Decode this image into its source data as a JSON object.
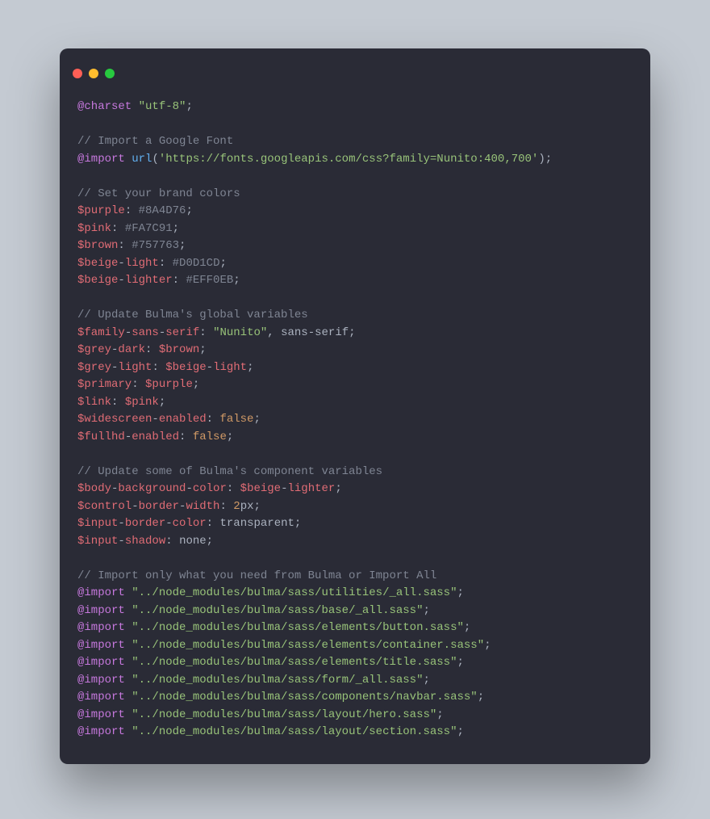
{
  "lines": [
    [
      {
        "cls": "tk-kw",
        "t": "@charset "
      },
      {
        "cls": "tk-str",
        "t": "\"utf-8\""
      },
      {
        "cls": "tk-punct",
        "t": ";"
      }
    ],
    [],
    [
      {
        "cls": "tk-comment",
        "t": "// Import a Google Font"
      }
    ],
    [
      {
        "cls": "tk-kw",
        "t": "@import "
      },
      {
        "cls": "tk-fn",
        "t": "url"
      },
      {
        "cls": "tk-punct",
        "t": "("
      },
      {
        "cls": "tk-str",
        "t": "'https://fonts.googleapis.com/css?family=Nunito:400,700'"
      },
      {
        "cls": "tk-punct",
        "t": ");"
      }
    ],
    [],
    [
      {
        "cls": "tk-comment",
        "t": "// Set your brand colors"
      }
    ],
    [
      {
        "cls": "tk-prop",
        "t": "$purple"
      },
      {
        "cls": "tk-punct",
        "t": ": "
      },
      {
        "cls": "tk-hex",
        "t": "#8A4D76"
      },
      {
        "cls": "tk-punct",
        "t": ";"
      }
    ],
    [
      {
        "cls": "tk-prop",
        "t": "$pink"
      },
      {
        "cls": "tk-punct",
        "t": ": "
      },
      {
        "cls": "tk-hex",
        "t": "#FA7C91"
      },
      {
        "cls": "tk-punct",
        "t": ";"
      }
    ],
    [
      {
        "cls": "tk-prop",
        "t": "$brown"
      },
      {
        "cls": "tk-punct",
        "t": ": "
      },
      {
        "cls": "tk-hex",
        "t": "#757763"
      },
      {
        "cls": "tk-punct",
        "t": ";"
      }
    ],
    [
      {
        "cls": "tk-prop",
        "t": "$beige"
      },
      {
        "cls": "tk-punct",
        "t": "-"
      },
      {
        "cls": "tk-prop",
        "t": "light"
      },
      {
        "cls": "tk-punct",
        "t": ": "
      },
      {
        "cls": "tk-hex",
        "t": "#D0D1CD"
      },
      {
        "cls": "tk-punct",
        "t": ";"
      }
    ],
    [
      {
        "cls": "tk-prop",
        "t": "$beige"
      },
      {
        "cls": "tk-punct",
        "t": "-"
      },
      {
        "cls": "tk-prop",
        "t": "lighter"
      },
      {
        "cls": "tk-punct",
        "t": ": "
      },
      {
        "cls": "tk-hex",
        "t": "#EFF0EB"
      },
      {
        "cls": "tk-punct",
        "t": ";"
      }
    ],
    [],
    [
      {
        "cls": "tk-comment",
        "t": "// Update Bulma's global variables"
      }
    ],
    [
      {
        "cls": "tk-prop",
        "t": "$family"
      },
      {
        "cls": "tk-punct",
        "t": "-"
      },
      {
        "cls": "tk-prop",
        "t": "sans"
      },
      {
        "cls": "tk-punct",
        "t": "-"
      },
      {
        "cls": "tk-prop",
        "t": "serif"
      },
      {
        "cls": "tk-punct",
        "t": ": "
      },
      {
        "cls": "tk-str",
        "t": "\"Nunito\""
      },
      {
        "cls": "tk-punct",
        "t": ", "
      },
      {
        "cls": "tk-plain",
        "t": "sans"
      },
      {
        "cls": "tk-punct",
        "t": "-"
      },
      {
        "cls": "tk-plain",
        "t": "serif"
      },
      {
        "cls": "tk-punct",
        "t": ";"
      }
    ],
    [
      {
        "cls": "tk-prop",
        "t": "$grey"
      },
      {
        "cls": "tk-punct",
        "t": "-"
      },
      {
        "cls": "tk-prop",
        "t": "dark"
      },
      {
        "cls": "tk-punct",
        "t": ": "
      },
      {
        "cls": "tk-prop",
        "t": "$brown"
      },
      {
        "cls": "tk-punct",
        "t": ";"
      }
    ],
    [
      {
        "cls": "tk-prop",
        "t": "$grey"
      },
      {
        "cls": "tk-punct",
        "t": "-"
      },
      {
        "cls": "tk-prop",
        "t": "light"
      },
      {
        "cls": "tk-punct",
        "t": ": "
      },
      {
        "cls": "tk-prop",
        "t": "$beige"
      },
      {
        "cls": "tk-punct",
        "t": "-"
      },
      {
        "cls": "tk-prop",
        "t": "light"
      },
      {
        "cls": "tk-punct",
        "t": ";"
      }
    ],
    [
      {
        "cls": "tk-prop",
        "t": "$primary"
      },
      {
        "cls": "tk-punct",
        "t": ": "
      },
      {
        "cls": "tk-prop",
        "t": "$purple"
      },
      {
        "cls": "tk-punct",
        "t": ";"
      }
    ],
    [
      {
        "cls": "tk-prop",
        "t": "$link"
      },
      {
        "cls": "tk-punct",
        "t": ": "
      },
      {
        "cls": "tk-prop",
        "t": "$pink"
      },
      {
        "cls": "tk-punct",
        "t": ";"
      }
    ],
    [
      {
        "cls": "tk-prop",
        "t": "$widescreen"
      },
      {
        "cls": "tk-punct",
        "t": "-"
      },
      {
        "cls": "tk-prop",
        "t": "enabled"
      },
      {
        "cls": "tk-punct",
        "t": ": "
      },
      {
        "cls": "tk-val",
        "t": "false"
      },
      {
        "cls": "tk-punct",
        "t": ";"
      }
    ],
    [
      {
        "cls": "tk-prop",
        "t": "$fullhd"
      },
      {
        "cls": "tk-punct",
        "t": "-"
      },
      {
        "cls": "tk-prop",
        "t": "enabled"
      },
      {
        "cls": "tk-punct",
        "t": ": "
      },
      {
        "cls": "tk-val",
        "t": "false"
      },
      {
        "cls": "tk-punct",
        "t": ";"
      }
    ],
    [],
    [
      {
        "cls": "tk-comment",
        "t": "// Update some of Bulma's component variables"
      }
    ],
    [
      {
        "cls": "tk-prop",
        "t": "$body"
      },
      {
        "cls": "tk-punct",
        "t": "-"
      },
      {
        "cls": "tk-prop",
        "t": "background"
      },
      {
        "cls": "tk-punct",
        "t": "-"
      },
      {
        "cls": "tk-prop",
        "t": "color"
      },
      {
        "cls": "tk-punct",
        "t": ": "
      },
      {
        "cls": "tk-prop",
        "t": "$beige"
      },
      {
        "cls": "tk-punct",
        "t": "-"
      },
      {
        "cls": "tk-prop",
        "t": "lighter"
      },
      {
        "cls": "tk-punct",
        "t": ";"
      }
    ],
    [
      {
        "cls": "tk-prop",
        "t": "$control"
      },
      {
        "cls": "tk-punct",
        "t": "-"
      },
      {
        "cls": "tk-prop",
        "t": "border"
      },
      {
        "cls": "tk-punct",
        "t": "-"
      },
      {
        "cls": "tk-prop",
        "t": "width"
      },
      {
        "cls": "tk-punct",
        "t": ": "
      },
      {
        "cls": "tk-val",
        "t": "2"
      },
      {
        "cls": "tk-plain",
        "t": "px"
      },
      {
        "cls": "tk-punct",
        "t": ";"
      }
    ],
    [
      {
        "cls": "tk-prop",
        "t": "$input"
      },
      {
        "cls": "tk-punct",
        "t": "-"
      },
      {
        "cls": "tk-prop",
        "t": "border"
      },
      {
        "cls": "tk-punct",
        "t": "-"
      },
      {
        "cls": "tk-prop",
        "t": "color"
      },
      {
        "cls": "tk-punct",
        "t": ": "
      },
      {
        "cls": "tk-plain",
        "t": "transparent"
      },
      {
        "cls": "tk-punct",
        "t": ";"
      }
    ],
    [
      {
        "cls": "tk-prop",
        "t": "$input"
      },
      {
        "cls": "tk-punct",
        "t": "-"
      },
      {
        "cls": "tk-prop",
        "t": "shadow"
      },
      {
        "cls": "tk-punct",
        "t": ": "
      },
      {
        "cls": "tk-plain",
        "t": "none"
      },
      {
        "cls": "tk-punct",
        "t": ";"
      }
    ],
    [],
    [
      {
        "cls": "tk-comment",
        "t": "// Import only what you need from Bulma or Import All"
      }
    ],
    [
      {
        "cls": "tk-kw",
        "t": "@import "
      },
      {
        "cls": "tk-str",
        "t": "\"../node_modules/bulma/sass/utilities/_all.sass\""
      },
      {
        "cls": "tk-punct",
        "t": ";"
      }
    ],
    [
      {
        "cls": "tk-kw",
        "t": "@import "
      },
      {
        "cls": "tk-str",
        "t": "\"../node_modules/bulma/sass/base/_all.sass\""
      },
      {
        "cls": "tk-punct",
        "t": ";"
      }
    ],
    [
      {
        "cls": "tk-kw",
        "t": "@import "
      },
      {
        "cls": "tk-str",
        "t": "\"../node_modules/bulma/sass/elements/button.sass\""
      },
      {
        "cls": "tk-punct",
        "t": ";"
      }
    ],
    [
      {
        "cls": "tk-kw",
        "t": "@import "
      },
      {
        "cls": "tk-str",
        "t": "\"../node_modules/bulma/sass/elements/container.sass\""
      },
      {
        "cls": "tk-punct",
        "t": ";"
      }
    ],
    [
      {
        "cls": "tk-kw",
        "t": "@import "
      },
      {
        "cls": "tk-str",
        "t": "\"../node_modules/bulma/sass/elements/title.sass\""
      },
      {
        "cls": "tk-punct",
        "t": ";"
      }
    ],
    [
      {
        "cls": "tk-kw",
        "t": "@import "
      },
      {
        "cls": "tk-str",
        "t": "\"../node_modules/bulma/sass/form/_all.sass\""
      },
      {
        "cls": "tk-punct",
        "t": ";"
      }
    ],
    [
      {
        "cls": "tk-kw",
        "t": "@import "
      },
      {
        "cls": "tk-str",
        "t": "\"../node_modules/bulma/sass/components/navbar.sass\""
      },
      {
        "cls": "tk-punct",
        "t": ";"
      }
    ],
    [
      {
        "cls": "tk-kw",
        "t": "@import "
      },
      {
        "cls": "tk-str",
        "t": "\"../node_modules/bulma/sass/layout/hero.sass\""
      },
      {
        "cls": "tk-punct",
        "t": ";"
      }
    ],
    [
      {
        "cls": "tk-kw",
        "t": "@import "
      },
      {
        "cls": "tk-str",
        "t": "\"../node_modules/bulma/sass/layout/section.sass\""
      },
      {
        "cls": "tk-punct",
        "t": ";"
      }
    ]
  ]
}
